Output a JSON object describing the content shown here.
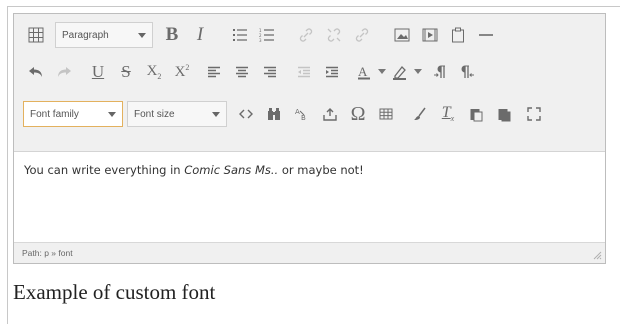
{
  "toolbar": {
    "format_select": "Paragraph",
    "font_family_select": "Font family",
    "font_size_select": "Font size"
  },
  "content": {
    "text_before": "You can write everything in ",
    "text_italic": "Comic Sans Ms..",
    "text_after": " or maybe not!"
  },
  "status": {
    "path": "Path: p » font"
  },
  "caption": "Example of custom font",
  "colors": {
    "focus_border": "#e3b15e",
    "icon": "#6b6b6b",
    "disabled": "#c4c4c4"
  }
}
